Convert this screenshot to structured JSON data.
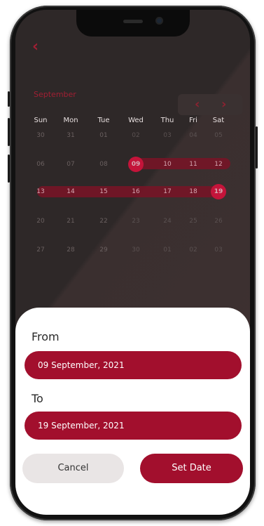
{
  "header": {
    "back_icon": "chevron-left-icon",
    "month": "September"
  },
  "nav": {
    "prev": "‹",
    "next": "›"
  },
  "weekdays": [
    "Sun",
    "Mon",
    "Tue",
    "Wed",
    "Thu",
    "Fri",
    "Sat"
  ],
  "weeks": [
    [
      "30",
      "31",
      "01",
      "02",
      "03",
      "04",
      "05"
    ],
    [
      "06",
      "07",
      "08",
      "09",
      "10",
      "11",
      "12"
    ],
    [
      "13",
      "14",
      "15",
      "16",
      "17",
      "18",
      "19"
    ],
    [
      "20",
      "21",
      "22",
      "23",
      "24",
      "25",
      "26"
    ],
    [
      "27",
      "28",
      "29",
      "30",
      "01",
      "02",
      "03"
    ]
  ],
  "selection": {
    "start": "09",
    "end": "19",
    "color": "#a20f2d"
  },
  "sheet": {
    "from_label": "From",
    "from_value": "09 September, 2021",
    "to_label": "To",
    "to_value": "19 September, 2021",
    "cancel": "Cancel",
    "set_date": "Set Date"
  }
}
